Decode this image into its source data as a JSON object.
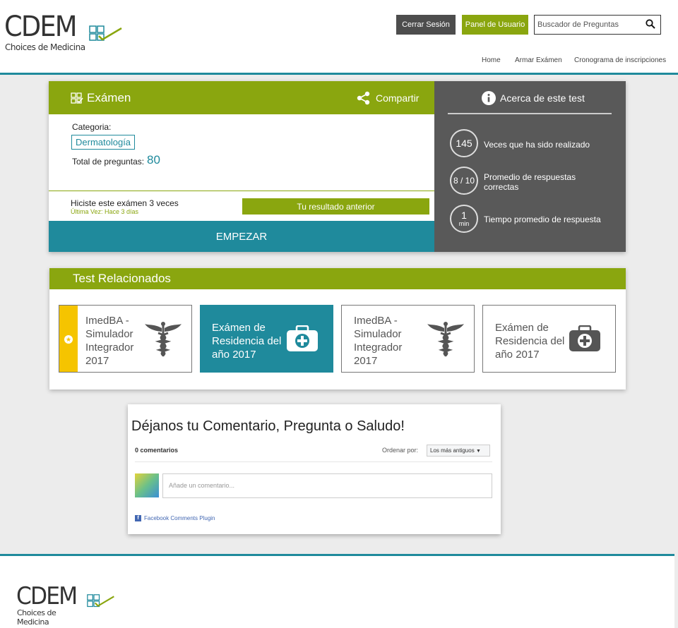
{
  "brand": {
    "name": "CDEM",
    "tagline": "Choices de Medicina"
  },
  "header": {
    "logout": "Cerrar Sesión",
    "panel": "Panel de Usuario",
    "search_placeholder": "Buscador de Preguntas",
    "nav": [
      "Home",
      "Armar Exámen",
      "Cronograma de inscripciones"
    ]
  },
  "exam": {
    "title": "Exámen",
    "share": "Compartir",
    "category_label": "Categoria:",
    "category": "Dermatología",
    "total_label": "Total de preguntas:",
    "total": "80",
    "done_text": "Hiciste este exámen 3 veces",
    "last_time": "Última Vez:  Hace 3 días",
    "prev_result": "Tu resultado anterior",
    "start": "EMPEZAR"
  },
  "about": {
    "title": "Acerca de este test",
    "stats": [
      {
        "value": "145",
        "unit": "",
        "label": "Veces que ha sido realizado"
      },
      {
        "value": "8 / 10",
        "unit": "",
        "label": "Promedio de respuestas correctas"
      },
      {
        "value": "1",
        "unit": "min",
        "label": "Tiempo promedio de respuesta"
      }
    ]
  },
  "related": {
    "title": "Test Relacionados",
    "cards": [
      {
        "text": "ImedBA - Simulador Integrador 2017",
        "icon": "caduceus-icon"
      },
      {
        "text": "Exámen de Residencia del año 2017",
        "icon": "medical-kit-icon"
      },
      {
        "text": "ImedBA - Simulador Integrador 2017",
        "icon": "caduceus-icon"
      },
      {
        "text": "Exámen de Residencia del año 2017",
        "icon": "medical-kit-icon"
      }
    ]
  },
  "comments": {
    "title": "Déjanos tu Comentario, Pregunta o Saludo!",
    "count": "0 comentarios",
    "sort_label": "Ordenar por:",
    "sort_value": "Los más antiguos",
    "input_placeholder": "Añade un comentario...",
    "plugin": "Facebook Comments Plugin"
  },
  "colors": {
    "green": "#8aa60f",
    "teal": "#1f8a9c",
    "dark": "#595959",
    "yellow": "#f5c400"
  }
}
